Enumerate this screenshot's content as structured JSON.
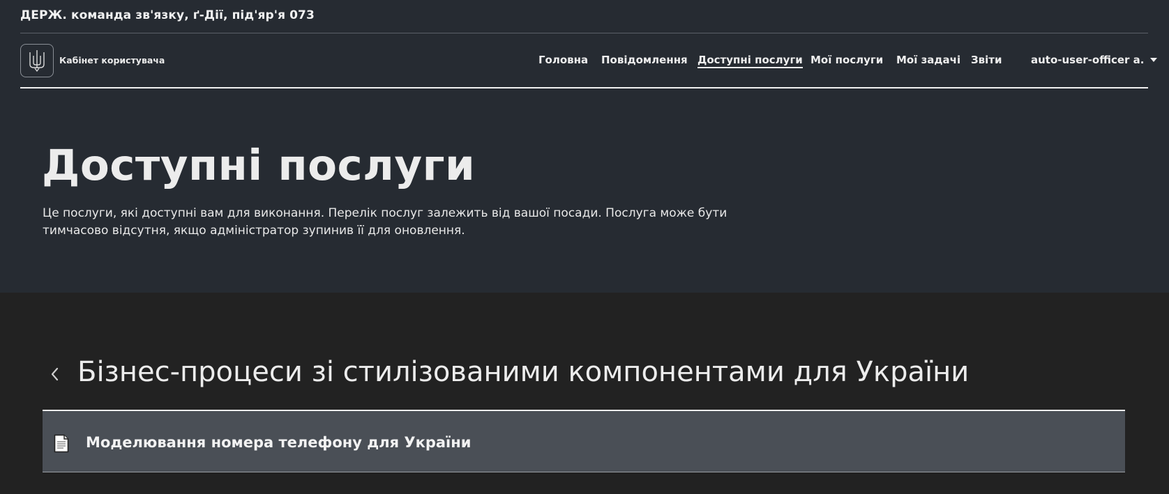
{
  "header": {
    "org_title": "ДЕРЖ. команда зв'язку, ґ-Дії, під'яр'я 073",
    "logo_caption": "Кабінет користувача"
  },
  "nav": {
    "items": [
      {
        "label": "Головна",
        "active": false
      },
      {
        "label": "Повідомлення",
        "active": false
      },
      {
        "label": "Доступні послуги",
        "active": true
      },
      {
        "label": "Мої послуги",
        "active": false
      },
      {
        "label": "Мої задачі",
        "active": false
      },
      {
        "label": "Звіти",
        "active": false
      }
    ],
    "user": "auto-user-officer a."
  },
  "hero": {
    "title": "Доступні послуги",
    "description": "Це послуги, які доступні вам для виконання. Перелік послуг залежить від вашої посади. Послуга може бути тимчасово відсутня, якщо адміністратор зупинив її для оновлення."
  },
  "section": {
    "title": "Бізнес-процеси зі стилізованими компонентами для України",
    "back_icon": "chevron-left-icon",
    "services": [
      {
        "label": "Моделювання номера телефону для України",
        "icon": "document-icon"
      }
    ]
  },
  "colors": {
    "top_band": "#262b32",
    "body_bg": "#222222",
    "row_bg": "#4a4f56",
    "text": "#ececec"
  }
}
